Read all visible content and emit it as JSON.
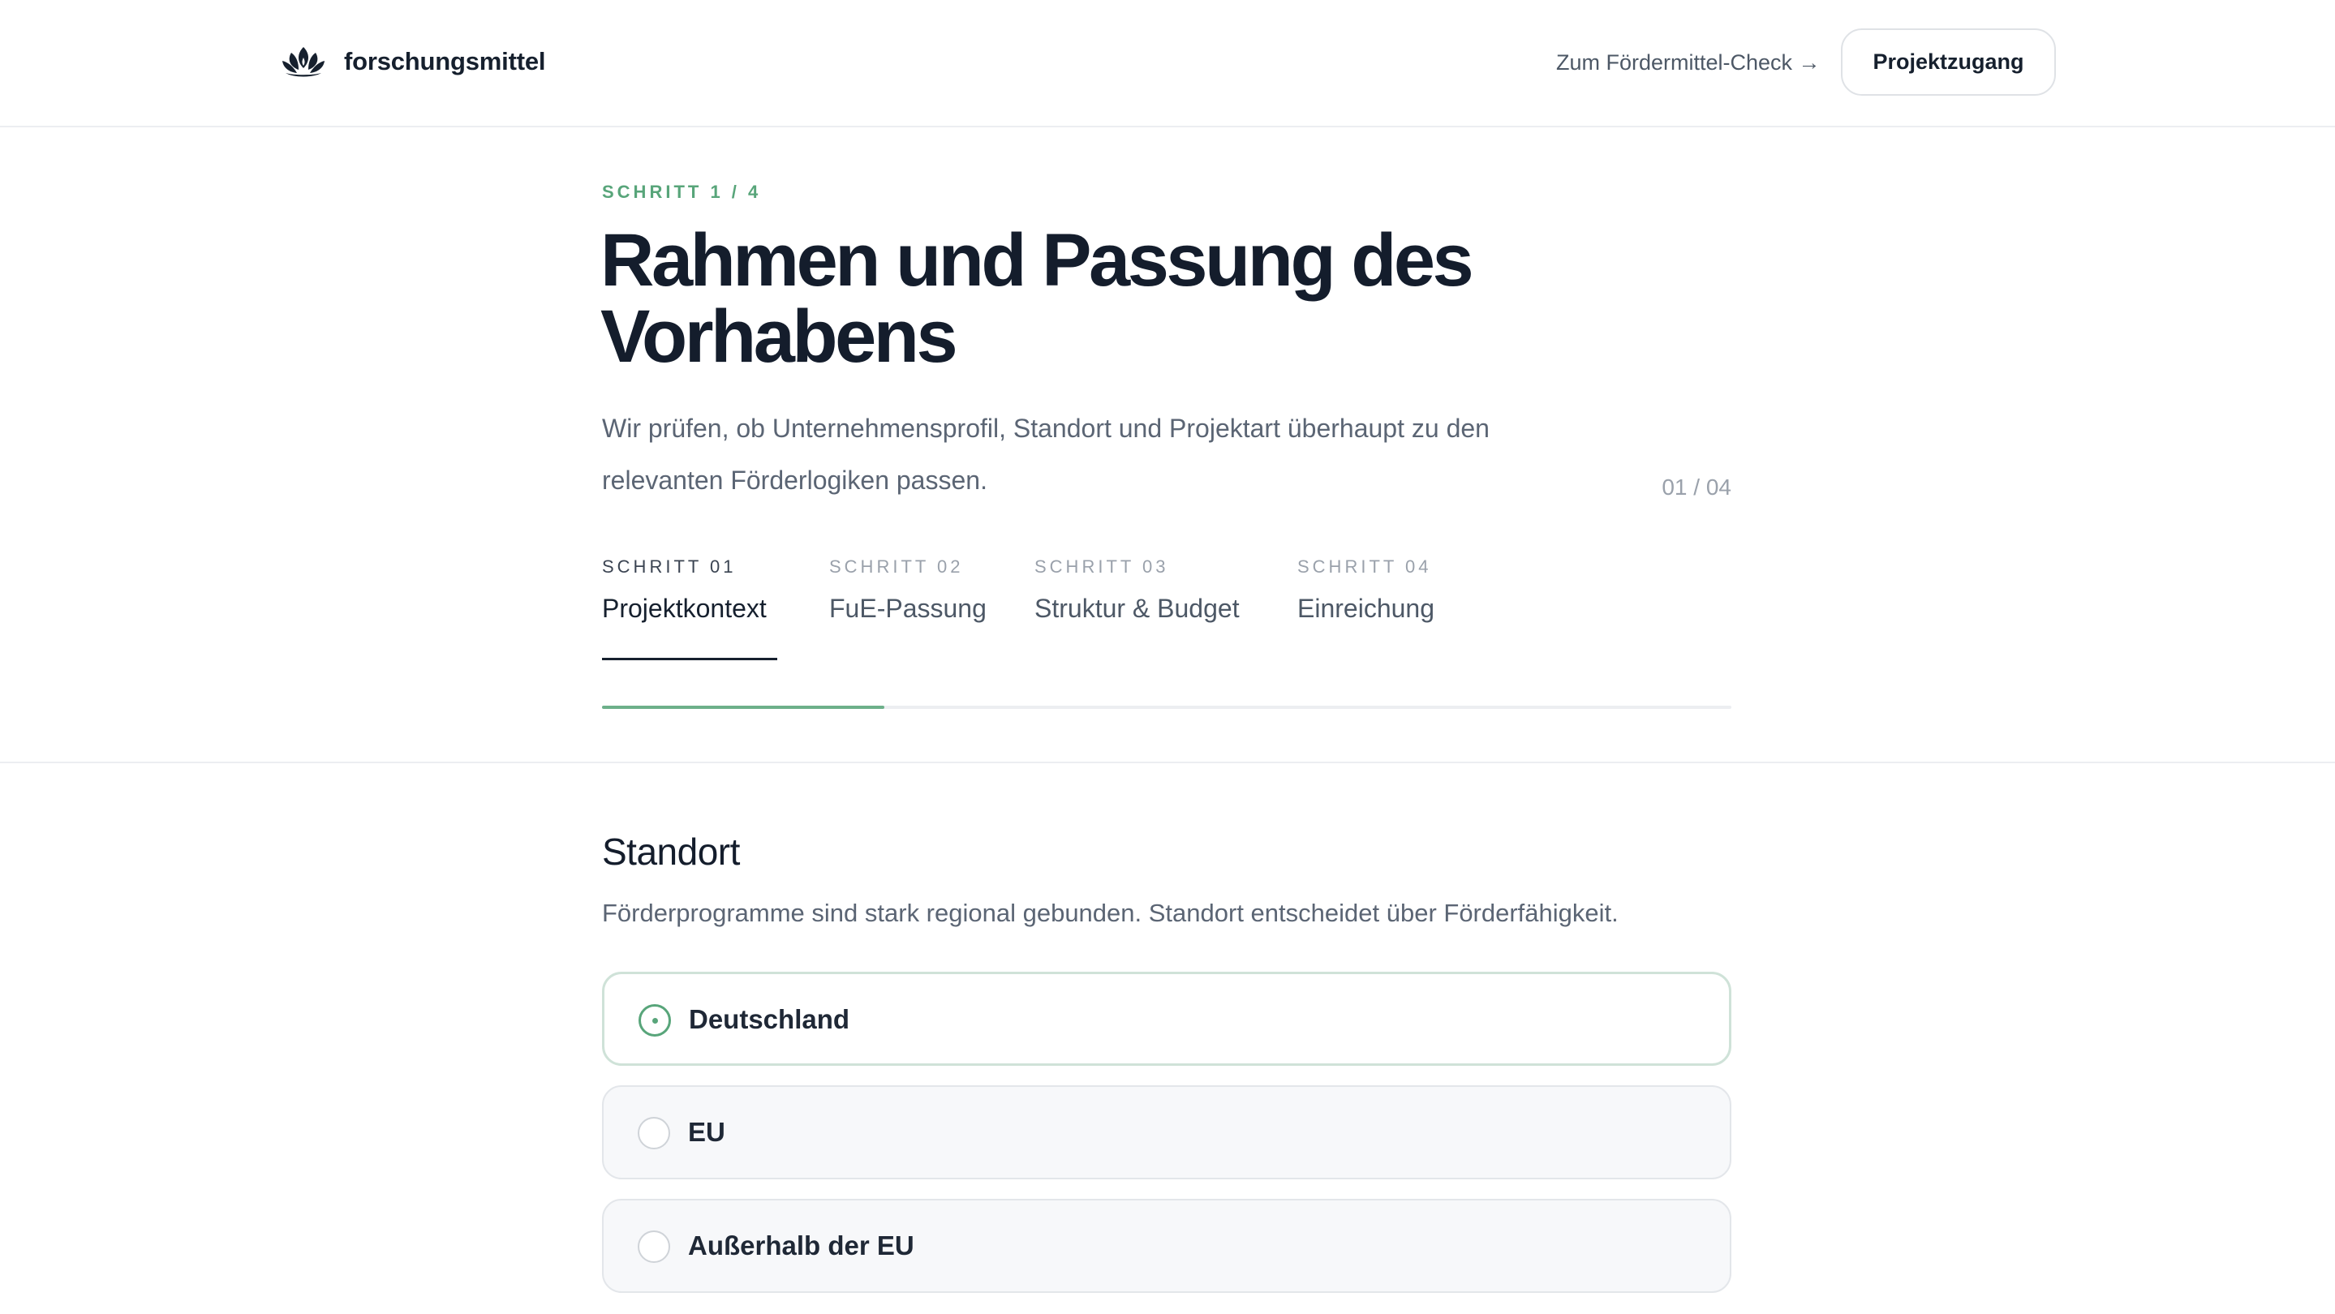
{
  "brand": {
    "name": "forschungsmittel",
    "icon": "lotus-logo-icon"
  },
  "nav": {
    "check_link": "Zum Fördermittel-Check →",
    "access_button": "Projektzugang"
  },
  "intro": {
    "kicker": "SCHRITT 1 / 4",
    "title": "Rahmen und Passung des Vorhabens",
    "lead": "Wir prüfen, ob Unternehmensprofil, Standort und Projektart überhaupt zu den relevanten Förderlogiken passen.",
    "counter": "01 / 04"
  },
  "steps": [
    {
      "number": "SCHRITT 01",
      "label": "Projektkontext",
      "active": true
    },
    {
      "number": "SCHRITT 02",
      "label": "FuE-Passung",
      "active": false
    },
    {
      "number": "SCHRITT 03",
      "label": "Struktur & Budget",
      "active": false
    },
    {
      "number": "SCHRITT 04",
      "label": "Einreichung",
      "active": false
    }
  ],
  "progress": {
    "fraction": 0.25,
    "color": "#6db08a"
  },
  "question": {
    "title": "Standort",
    "description": "Förderprogramme sind stark regional gebunden. Standort entscheidet über Förderfähigkeit.",
    "options": [
      {
        "label": "Deutschland",
        "selected": true
      },
      {
        "label": "EU",
        "selected": false
      },
      {
        "label": "Außerhalb der EU",
        "selected": false
      }
    ]
  },
  "colors": {
    "accent": "#58a57a",
    "text": "#141d2c",
    "muted": "#5b6574"
  }
}
